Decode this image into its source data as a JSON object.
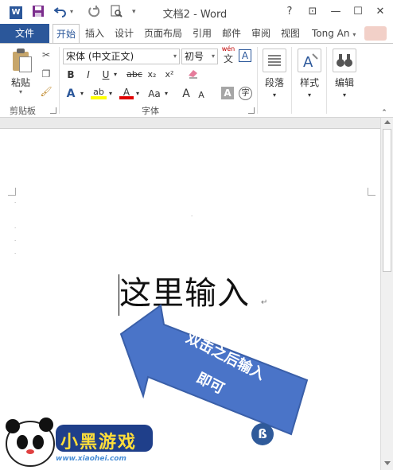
{
  "titlebar": {
    "app_icon_letter": "W",
    "title": "文档2 - Word",
    "help": "?",
    "buttons": {
      "ribbon_display": "⊡",
      "minimize": "—",
      "maximize": "☐",
      "close": "✕"
    }
  },
  "tabs": {
    "file": "文件",
    "items": [
      "开始",
      "插入",
      "设计",
      "页面布局",
      "引用",
      "邮件",
      "审阅",
      "视图"
    ],
    "active": "开始",
    "user": "Tong An"
  },
  "ribbon": {
    "clipboard": {
      "paste_label": "粘贴",
      "group_label": "剪贴板"
    },
    "font": {
      "font_name": "宋体 (中文正文)",
      "font_size": "初号",
      "wen_label": "wén",
      "wen_char": "文",
      "boxed_A": "A",
      "bold": "B",
      "italic": "I",
      "underline": "U",
      "strike": "abc",
      "subscript": "x₂",
      "superscript": "x²",
      "text_effects": "A",
      "highlight": "ab",
      "font_color": "A",
      "change_case": "Aa",
      "grow": "A",
      "shrink": "A",
      "char_shading": "A",
      "enclose": "字",
      "group_label": "字体"
    },
    "paragraph": {
      "label": "段落"
    },
    "styles": {
      "label": "样式"
    },
    "editing": {
      "label": "编辑"
    }
  },
  "document": {
    "text": "这里输入"
  },
  "callout": {
    "line1": "双击之后输入",
    "line2": "即可",
    "color": "#4472c4"
  },
  "watermark": {
    "brand_chars": "小黑游戏",
    "url": "www.xiaohei.com"
  },
  "colors": {
    "accent": "#2b579a",
    "highlight_yellow": "#ffff00",
    "font_red": "#e00000"
  }
}
